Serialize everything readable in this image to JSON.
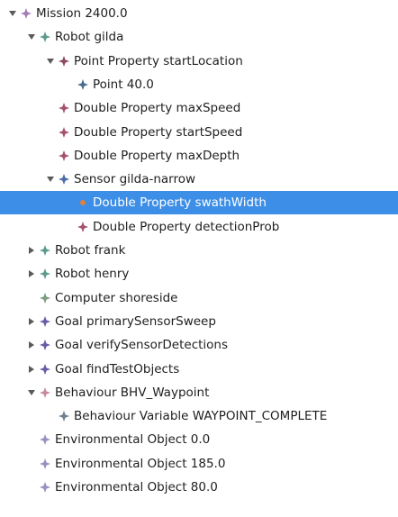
{
  "tree": {
    "selected_index": 9,
    "nodes": [
      {
        "label": "Mission 2400.0",
        "depth": 0,
        "expander": "expanded",
        "icon": "diamond-icon",
        "icon_color": "#a57bb6"
      },
      {
        "label": "Robot gilda",
        "depth": 1,
        "expander": "expanded",
        "icon": "diamond-icon",
        "icon_color": "#5c9b8b"
      },
      {
        "label": "Point Property startLocation",
        "depth": 2,
        "expander": "expanded",
        "icon": "diamond-icon",
        "icon_color": "#8b4a64"
      },
      {
        "label": "Point 40.0",
        "depth": 3,
        "expander": "none",
        "icon": "diamond-icon",
        "icon_color": "#4a6c8f"
      },
      {
        "label": "Double Property maxSpeed",
        "depth": 2,
        "expander": "none",
        "icon": "diamond-icon",
        "icon_color": "#a3526c"
      },
      {
        "label": "Double Property startSpeed",
        "depth": 2,
        "expander": "none",
        "icon": "diamond-icon",
        "icon_color": "#a3526c"
      },
      {
        "label": "Double Property maxDepth",
        "depth": 2,
        "expander": "none",
        "icon": "diamond-icon",
        "icon_color": "#a3526c"
      },
      {
        "label": "Sensor gilda-narrow",
        "depth": 2,
        "expander": "expanded",
        "icon": "diamond-icon",
        "icon_color": "#4a6aa8"
      },
      {
        "label": "Double Property swathWidth",
        "depth": 3,
        "expander": "none",
        "icon": "diamond-icon",
        "icon_color": "#e08040"
      },
      {
        "label": "Double Property detectionProb",
        "depth": 3,
        "expander": "none",
        "icon": "diamond-icon",
        "icon_color": "#a3526c"
      },
      {
        "label": "Robot frank",
        "depth": 1,
        "expander": "collapsed",
        "icon": "diamond-icon",
        "icon_color": "#5c9b8b"
      },
      {
        "label": "Robot henry",
        "depth": 1,
        "expander": "collapsed",
        "icon": "diamond-icon",
        "icon_color": "#5c9b8b"
      },
      {
        "label": "Computer shoreside",
        "depth": 1,
        "expander": "none",
        "icon": "diamond-icon",
        "icon_color": "#7c9c7c"
      },
      {
        "label": "Goal primarySensorSweep",
        "depth": 1,
        "expander": "collapsed",
        "icon": "diamond-icon",
        "icon_color": "#6a5aa8"
      },
      {
        "label": "Goal verifySensorDetections",
        "depth": 1,
        "expander": "collapsed",
        "icon": "diamond-icon",
        "icon_color": "#6a5aa8"
      },
      {
        "label": "Goal findTestObjects",
        "depth": 1,
        "expander": "collapsed",
        "icon": "diamond-icon",
        "icon_color": "#6a5aa8"
      },
      {
        "label": "Behaviour BHV_Waypoint",
        "depth": 1,
        "expander": "expanded",
        "icon": "diamond-icon",
        "icon_color": "#c88a9a"
      },
      {
        "label": "Behaviour Variable WAYPOINT_COMPLETE",
        "depth": 2,
        "expander": "none",
        "icon": "diamond-icon",
        "icon_color": "#6f7f8f"
      },
      {
        "label": "Environmental Object 0.0",
        "depth": 1,
        "expander": "none",
        "icon": "diamond-icon",
        "icon_color": "#9a8fc0"
      },
      {
        "label": "Environmental Object 185.0",
        "depth": 1,
        "expander": "none",
        "icon": "diamond-icon",
        "icon_color": "#9a8fc0"
      },
      {
        "label": "Environmental Object 80.0",
        "depth": 1,
        "expander": "none",
        "icon": "diamond-icon",
        "icon_color": "#9a8fc0"
      }
    ]
  },
  "colors": {
    "selection_bg": "#3d8ee6",
    "expander": "#5a5a5a"
  }
}
